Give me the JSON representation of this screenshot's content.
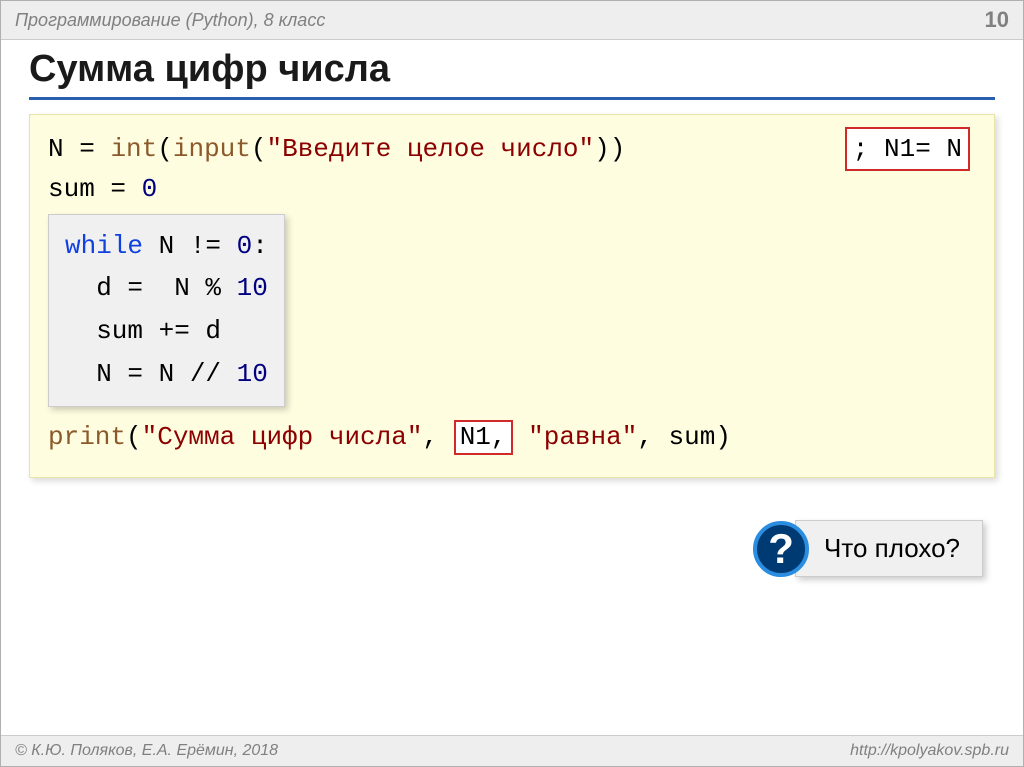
{
  "header": {
    "title": "Программирование (Python), 8 класс",
    "page": "10"
  },
  "title": "Сумма цифр числа",
  "code": {
    "line1": {
      "n": "N ",
      "eq": "= ",
      "int": "int",
      "lp": "(",
      "input": "input",
      "lp2": "(",
      "str": "\"Введите целое число\"",
      "rp": "))"
    },
    "hb1": "; N1= N",
    "line2": {
      "sum": "sum ",
      "eq": "= ",
      "zero": "0"
    },
    "inner": {
      "while": "while",
      "cond": " N != ",
      "zero": "0",
      "colon": ":",
      "d": "  d =  N % ",
      "ten": "10",
      "sumadd": "  sum += d",
      "nline": "  N = N // ",
      "ten2": "10"
    },
    "print": {
      "print": "print",
      "lp": "(",
      "s1": "\"Сумма цифр числа\"",
      "c1": ", ",
      "n1": "N1,",
      "sp": " ",
      "s2": "\"равна\"",
      "c2": ", sum)"
    }
  },
  "question": {
    "mark": "?",
    "text": "Что плохо?"
  },
  "footer": {
    "left": "© К.Ю. Поляков, Е.А. Ерёмин, 2018",
    "right": "http://kpolyakov.spb.ru"
  }
}
